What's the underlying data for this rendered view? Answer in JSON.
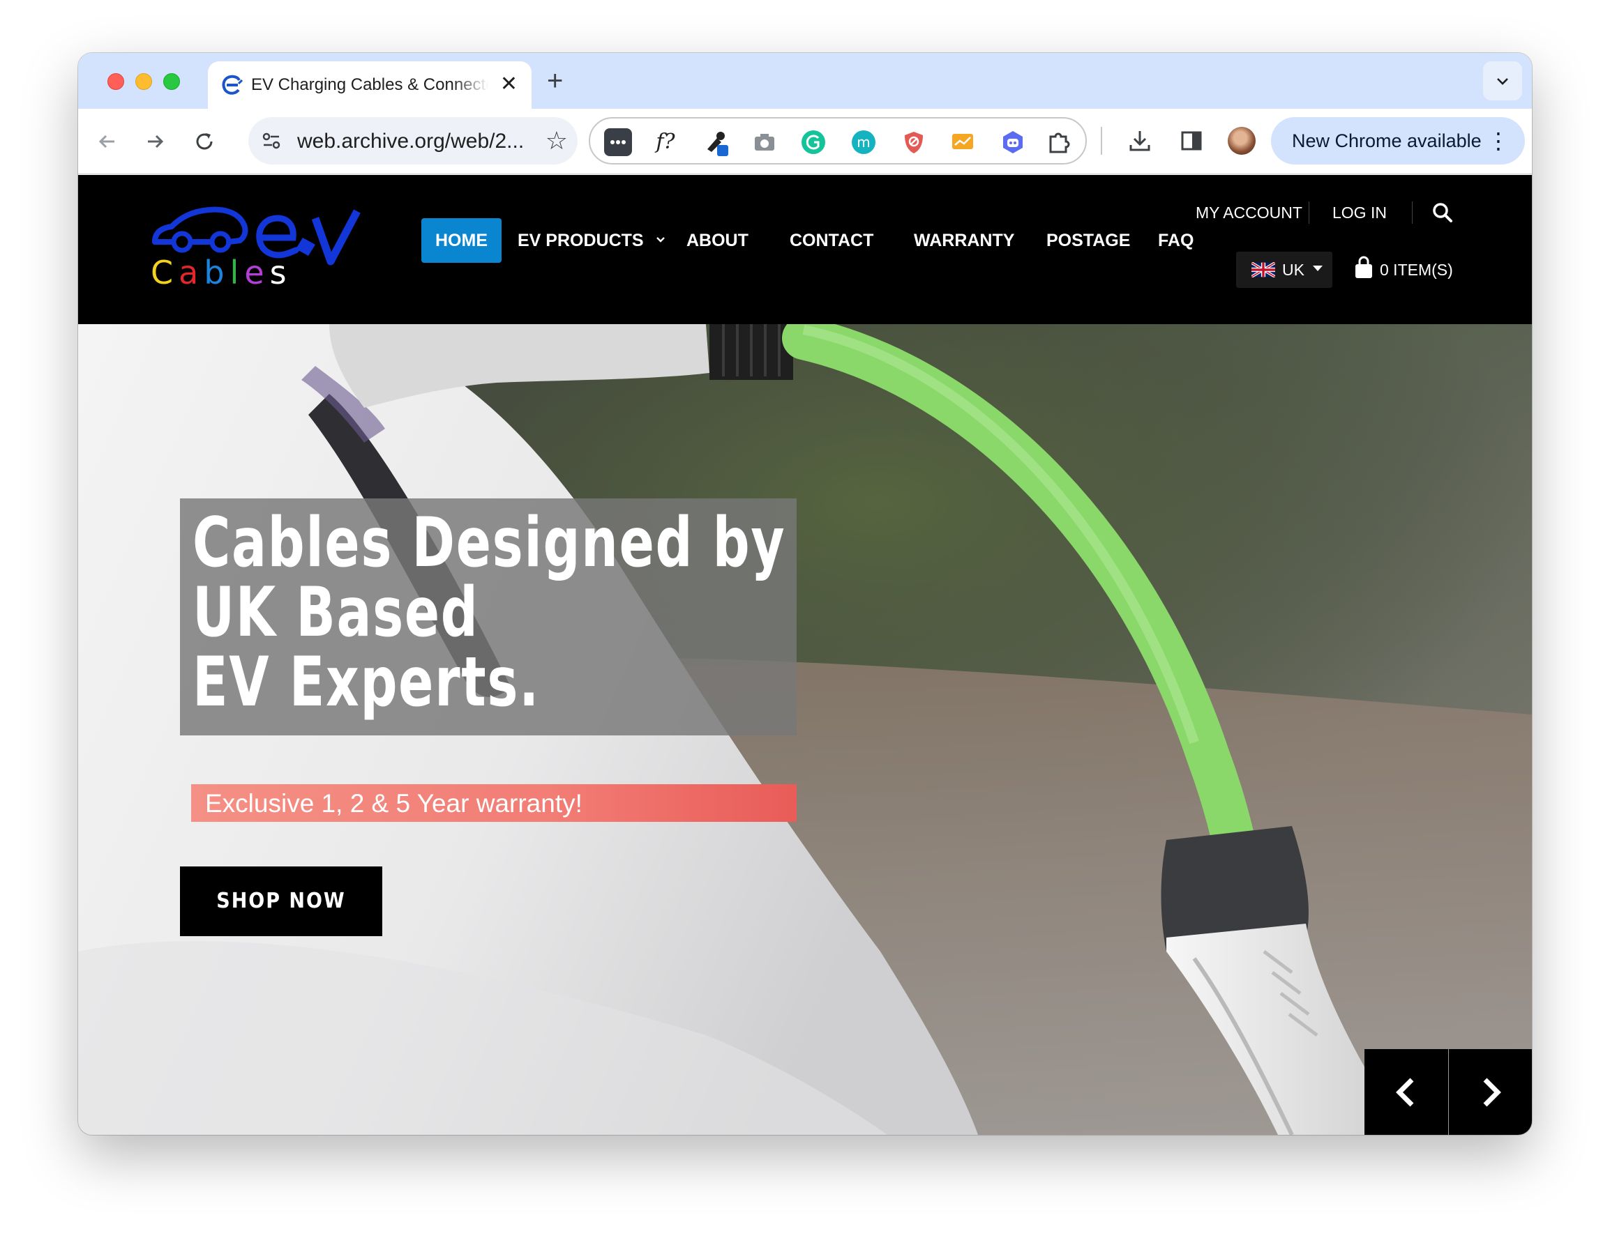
{
  "browser": {
    "tab_title": "EV Charging Cables & Connectors",
    "tab_close_symbol": "✕",
    "new_tab_symbol": "+",
    "address": "web.archive.org/web/2...",
    "update_label": "New Chrome available",
    "extension_f_label": "f?"
  },
  "header": {
    "logo_ev": "eV",
    "logo_cables_letters": [
      "C",
      "a",
      "b",
      "l",
      "e",
      "s"
    ],
    "logo_cables_colors": [
      "#f2d21c",
      "#e3262b",
      "#1b84e0",
      "#36b44a",
      "#b43fd6",
      "#ffffff"
    ],
    "nav": [
      {
        "label": "HOME",
        "active": true
      },
      {
        "label": "EV PRODUCTS",
        "has_dropdown": true
      },
      {
        "label": "ABOUT"
      },
      {
        "label": "CONTACT"
      },
      {
        "label": "WARRANTY"
      },
      {
        "label": "POSTAGE"
      },
      {
        "label": "FAQ"
      }
    ],
    "my_account": "MY ACCOUNT",
    "log_in": "LOG IN",
    "language": "UK",
    "cart": "0 ITEM(S)"
  },
  "hero": {
    "headline_lines": [
      "Cables Designed by",
      "UK Based",
      "EV Experts."
    ],
    "warranty": "Exclusive 1, 2 & 5 Year warranty!",
    "cta": "SHOP NOW"
  },
  "colors": {
    "brand_blue": "#0a86d0",
    "logo_blue": "#1236d8",
    "warranty_red": "#f27d75",
    "cable_green": "#8ad76a"
  },
  "icons": [
    "back-arrow-icon",
    "forward-arrow-icon",
    "reload-icon",
    "site-settings-icon",
    "bookmark-star-icon",
    "extensions-puzzle-icon",
    "download-icon",
    "side-panel-icon",
    "search-icon",
    "cart-bag-icon",
    "chevron-left-icon",
    "chevron-right-icon"
  ]
}
